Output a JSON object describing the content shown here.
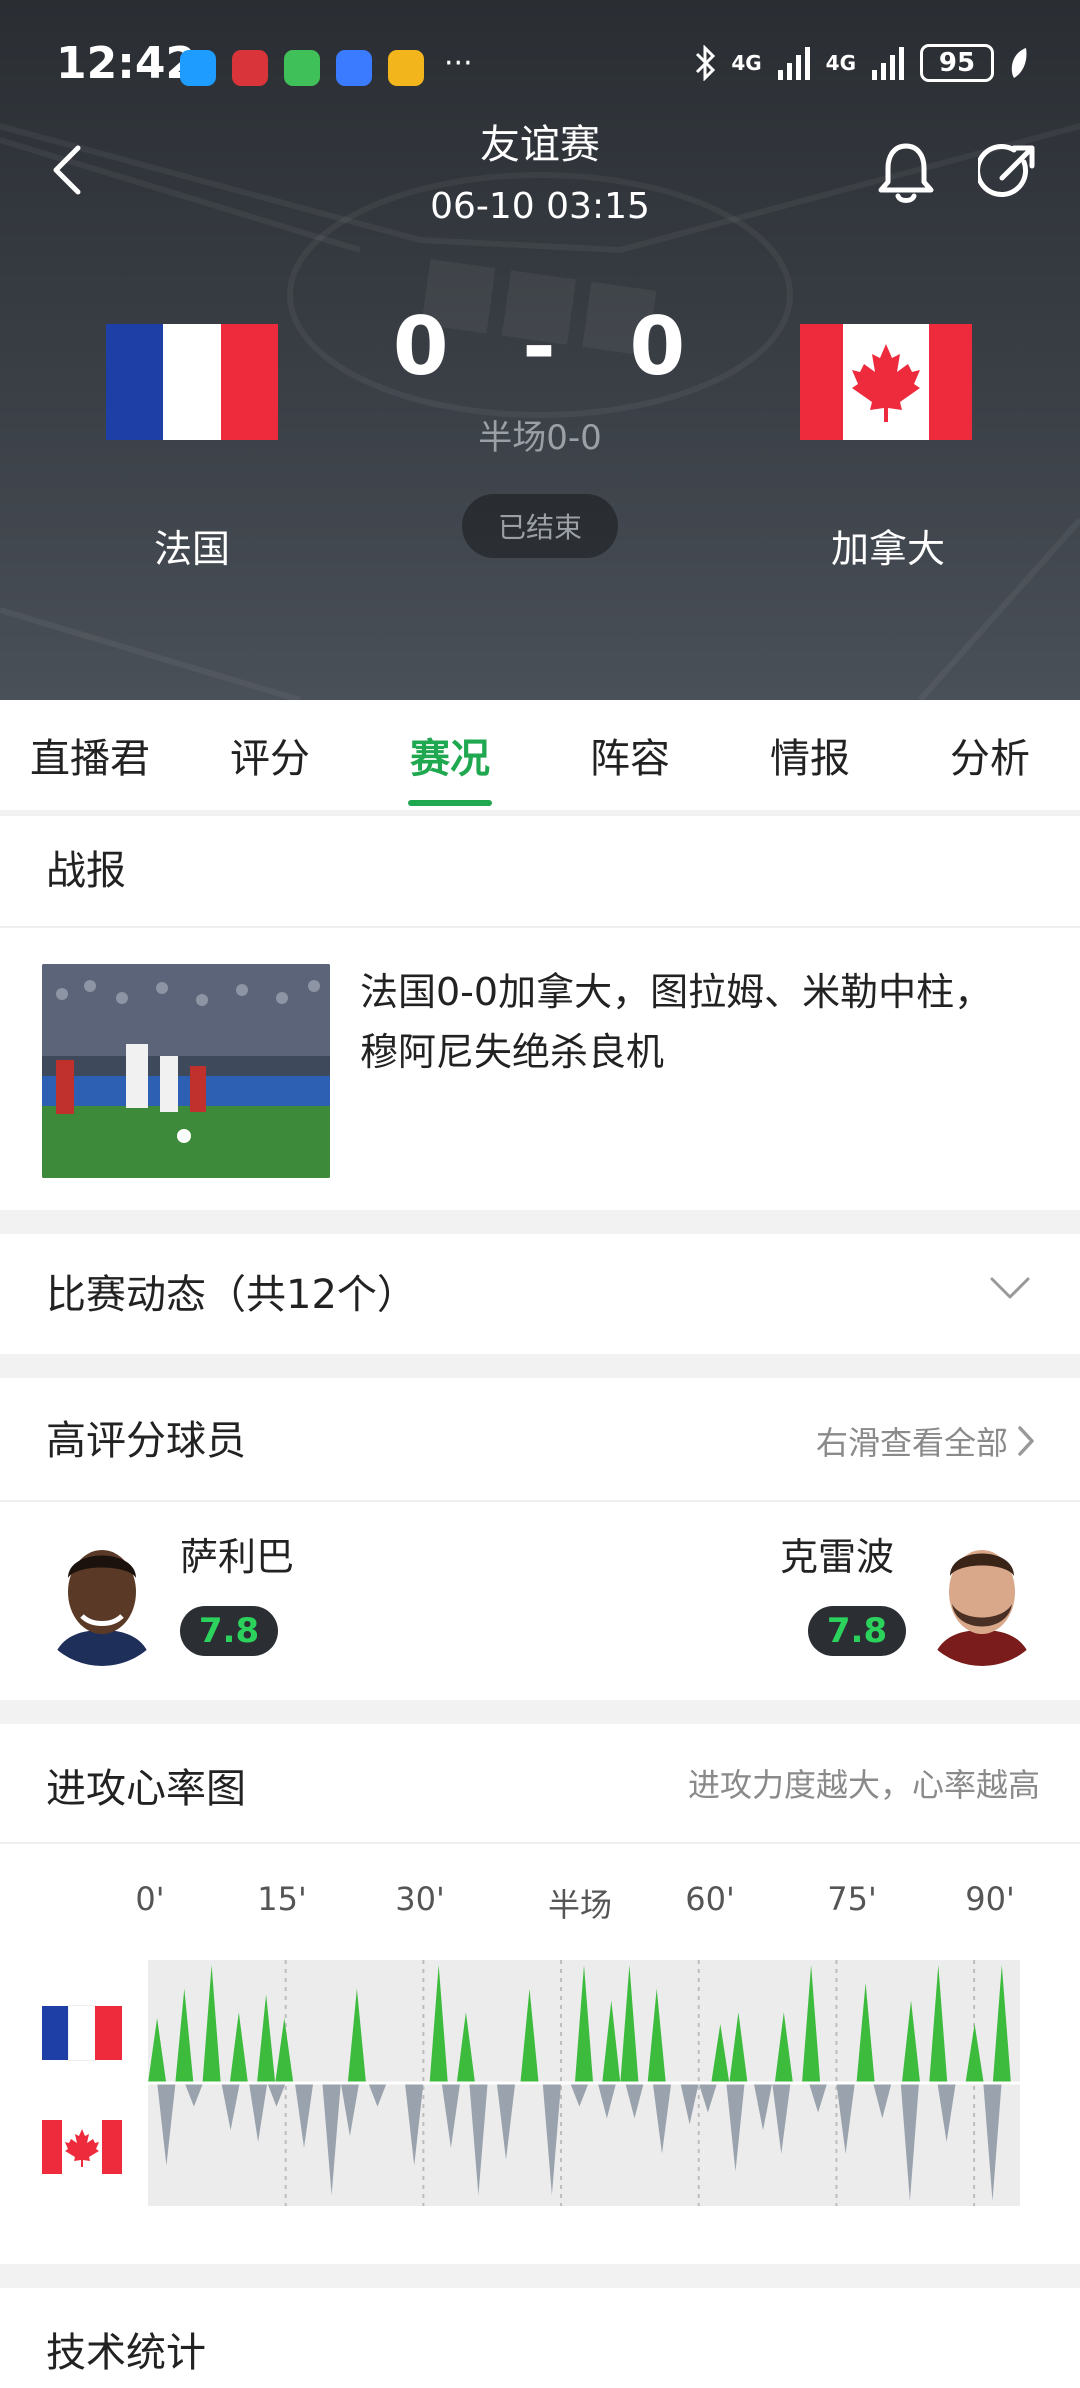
{
  "status_bar": {
    "time": "12:42",
    "network_1": "4G",
    "network_2": "4G",
    "battery": "95",
    "app_icons": [
      {
        "name": "message-app-icon",
        "color": "#1f9cff"
      },
      {
        "name": "bank-app-icon",
        "color": "#d9343a"
      },
      {
        "name": "sheet-app-icon",
        "color": "#3fc059"
      },
      {
        "name": "shield-app-icon",
        "color": "#3a7bff"
      },
      {
        "name": "paint-app-icon",
        "color": "#f2b51c"
      }
    ]
  },
  "match": {
    "title": "友谊赛",
    "datetime": "06-10 03:15",
    "home_score": "0",
    "separator": "-",
    "away_score": "0",
    "half_time": "半场0-0",
    "status": "已结束",
    "home_team": "法国",
    "away_team": "加拿大"
  },
  "tabs": [
    {
      "label": "直播君",
      "active": false
    },
    {
      "label": "评分",
      "active": false
    },
    {
      "label": "赛况",
      "active": true
    },
    {
      "label": "阵容",
      "active": false
    },
    {
      "label": "情报",
      "active": false
    },
    {
      "label": "分析",
      "active": false
    }
  ],
  "report": {
    "title": "战报",
    "headline": "法国0-0加拿大，图拉姆、米勒中柱，穆阿尼失绝杀良机"
  },
  "events": {
    "title": "比赛动态（共12个）"
  },
  "top_players": {
    "title": "高评分球员",
    "see_all": "右滑查看全部",
    "home_player": {
      "name": "萨利巴",
      "rating": "7.8"
    },
    "away_player": {
      "name": "克雷波",
      "rating": "7.8"
    }
  },
  "heart_rate": {
    "title": "进攻心率图",
    "subtitle": "进攻力度越大，心率越高",
    "ticks": [
      "0'",
      "15'",
      "30'",
      "半场",
      "60'",
      "75'",
      "90'"
    ]
  },
  "chart_data": {
    "type": "area",
    "x_range": [
      0,
      95
    ],
    "series": [
      {
        "team": "法国",
        "color": "#3dbb3d",
        "direction": "up",
        "values": [
          0,
          55,
          0,
          0,
          80,
          0,
          0,
          100,
          0,
          0,
          60,
          0,
          0,
          75,
          0,
          55,
          0,
          0,
          0,
          0,
          0,
          0,
          0,
          80,
          0,
          0,
          0,
          0,
          0,
          0,
          0,
          0,
          100,
          0,
          0,
          60,
          0,
          0,
          0,
          0,
          0,
          0,
          80,
          0,
          0,
          0,
          0,
          0,
          100,
          0,
          0,
          70,
          0,
          100,
          0,
          0,
          80,
          0,
          0,
          0,
          0,
          0,
          0,
          50,
          0,
          60,
          0,
          0,
          0,
          0,
          60,
          0,
          0,
          100,
          0,
          0,
          0,
          0,
          0,
          85,
          0,
          0,
          0,
          0,
          70,
          0,
          0,
          100,
          0,
          0,
          0,
          50,
          0,
          0,
          100,
          0,
          0
        ]
      },
      {
        "team": "加拿大",
        "color": "#9aa3ad",
        "direction": "down",
        "values": [
          0,
          0,
          70,
          0,
          0,
          20,
          0,
          0,
          0,
          40,
          0,
          0,
          50,
          0,
          20,
          0,
          0,
          55,
          0,
          0,
          95,
          0,
          45,
          0,
          0,
          20,
          0,
          0,
          0,
          70,
          0,
          0,
          0,
          55,
          0,
          0,
          95,
          0,
          0,
          65,
          0,
          0,
          0,
          0,
          95,
          0,
          0,
          20,
          0,
          0,
          30,
          0,
          0,
          30,
          0,
          0,
          60,
          0,
          0,
          35,
          0,
          25,
          0,
          0,
          75,
          0,
          0,
          40,
          0,
          60,
          0,
          0,
          0,
          25,
          0,
          0,
          60,
          0,
          0,
          0,
          30,
          0,
          0,
          100,
          0,
          0,
          0,
          50,
          0,
          0,
          0,
          0,
          100,
          0,
          0,
          0
        ]
      }
    ]
  },
  "stats": {
    "title": "技术统计"
  }
}
